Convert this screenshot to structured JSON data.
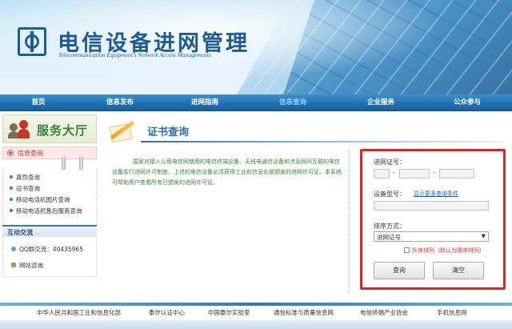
{
  "header": {
    "title": "电信设备进网管理",
    "subtitle": "Telecommunication Equipment's Network Access Managements"
  },
  "nav": {
    "items": [
      {
        "label": "首页"
      },
      {
        "label": "信息发布"
      },
      {
        "label": "进网指南"
      },
      {
        "label": "信息查询",
        "active": true
      },
      {
        "label": "企业服务"
      },
      {
        "label": "公众参与"
      }
    ]
  },
  "sidebar": {
    "hall_title": "服务大厅",
    "active_tab": "信息查询",
    "menu": [
      {
        "label": "真伪查询"
      },
      {
        "label": "证书查询"
      },
      {
        "label": "移动电话机图片查询"
      },
      {
        "label": "移动电话机售后服务查询"
      }
    ],
    "interact_title": "互动交流",
    "qq": "QQ群交流：40435965",
    "site": "网站咨询"
  },
  "main": {
    "title": "证书查询",
    "description": "国家对接入公用电信网使用的电信终端设备、无线电通信设备和涉及网间互联的电信设备实行进网许可制度。上述的电信设备必须获得工业和信息化部颁发的进网许可证。本系统可帮助用户查看所有已颁发的进网许可证。"
  },
  "search": {
    "cert_label": "进网证号：",
    "dash": "-",
    "cert_part1": "",
    "cert_part2": "",
    "cert_part3": "",
    "model_label": "设备型号：",
    "more_link": "显示更多查询条件",
    "model_value": "",
    "sort_label": "排序方式：",
    "sort_selected": "进网证号",
    "ascending_label": "升序排列（默认为降序排列）",
    "ascending_checked": false,
    "query_button": "查询",
    "clear_button": "清空",
    "highlight_color": "#e02424"
  },
  "footer": {
    "links": [
      "中华人民共和国工业和信息化部",
      "泰尔认证中心",
      "中国泰尔实验室",
      "通信标准与质量信息网",
      "电信终端产业协会",
      "手机信息网"
    ]
  },
  "colors": {
    "nav_bg": "#1f6fb0",
    "brand_blue": "#1d5a96",
    "sidebar_green": "#3b7f3a",
    "link_blue": "#1a5fb4"
  }
}
